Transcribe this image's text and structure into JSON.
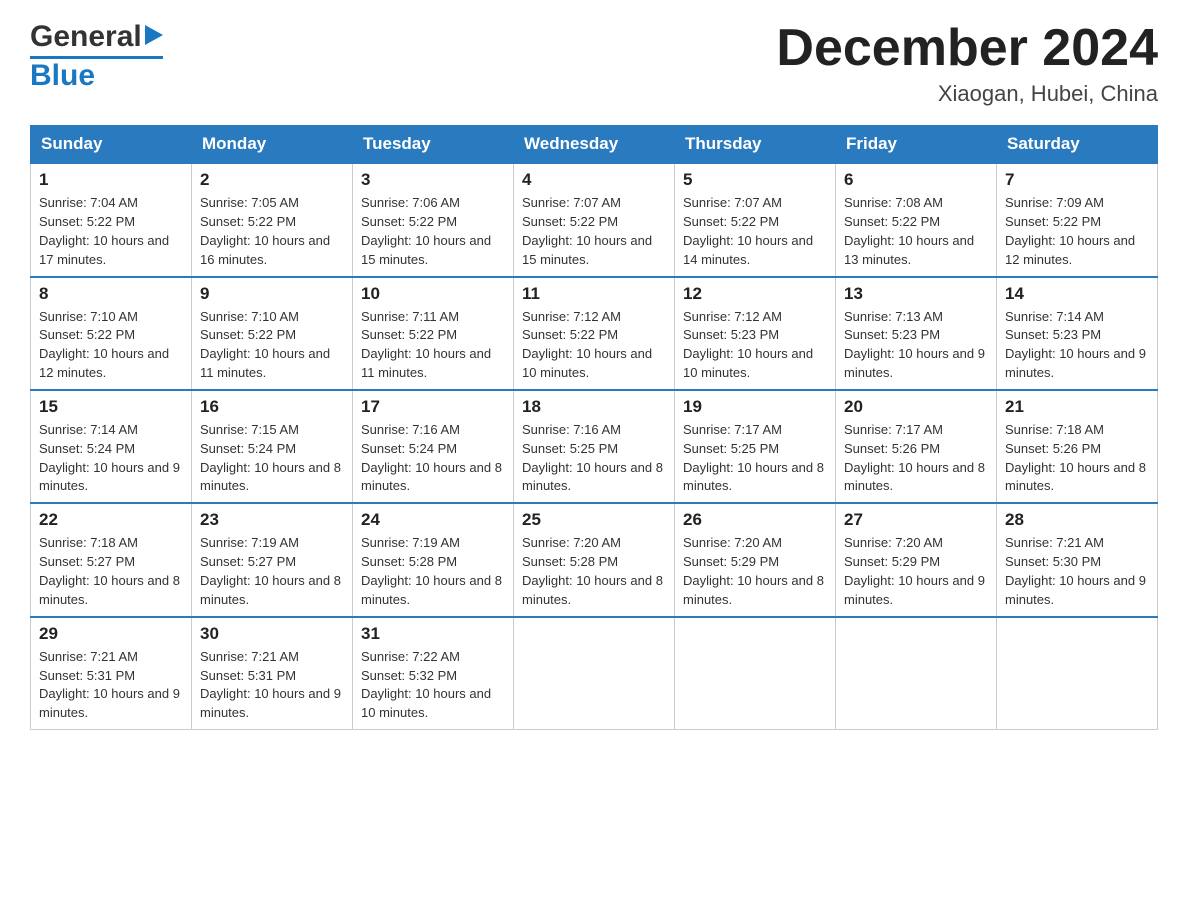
{
  "header": {
    "month_title": "December 2024",
    "location": "Xiaogan, Hubei, China",
    "logo_general": "General",
    "logo_blue": "Blue"
  },
  "days_of_week": [
    "Sunday",
    "Monday",
    "Tuesday",
    "Wednesday",
    "Thursday",
    "Friday",
    "Saturday"
  ],
  "weeks": [
    [
      {
        "day": "1",
        "sunrise": "7:04 AM",
        "sunset": "5:22 PM",
        "daylight": "10 hours and 17 minutes."
      },
      {
        "day": "2",
        "sunrise": "7:05 AM",
        "sunset": "5:22 PM",
        "daylight": "10 hours and 16 minutes."
      },
      {
        "day": "3",
        "sunrise": "7:06 AM",
        "sunset": "5:22 PM",
        "daylight": "10 hours and 15 minutes."
      },
      {
        "day": "4",
        "sunrise": "7:07 AM",
        "sunset": "5:22 PM",
        "daylight": "10 hours and 15 minutes."
      },
      {
        "day": "5",
        "sunrise": "7:07 AM",
        "sunset": "5:22 PM",
        "daylight": "10 hours and 14 minutes."
      },
      {
        "day": "6",
        "sunrise": "7:08 AM",
        "sunset": "5:22 PM",
        "daylight": "10 hours and 13 minutes."
      },
      {
        "day": "7",
        "sunrise": "7:09 AM",
        "sunset": "5:22 PM",
        "daylight": "10 hours and 12 minutes."
      }
    ],
    [
      {
        "day": "8",
        "sunrise": "7:10 AM",
        "sunset": "5:22 PM",
        "daylight": "10 hours and 12 minutes."
      },
      {
        "day": "9",
        "sunrise": "7:10 AM",
        "sunset": "5:22 PM",
        "daylight": "10 hours and 11 minutes."
      },
      {
        "day": "10",
        "sunrise": "7:11 AM",
        "sunset": "5:22 PM",
        "daylight": "10 hours and 11 minutes."
      },
      {
        "day": "11",
        "sunrise": "7:12 AM",
        "sunset": "5:22 PM",
        "daylight": "10 hours and 10 minutes."
      },
      {
        "day": "12",
        "sunrise": "7:12 AM",
        "sunset": "5:23 PM",
        "daylight": "10 hours and 10 minutes."
      },
      {
        "day": "13",
        "sunrise": "7:13 AM",
        "sunset": "5:23 PM",
        "daylight": "10 hours and 9 minutes."
      },
      {
        "day": "14",
        "sunrise": "7:14 AM",
        "sunset": "5:23 PM",
        "daylight": "10 hours and 9 minutes."
      }
    ],
    [
      {
        "day": "15",
        "sunrise": "7:14 AM",
        "sunset": "5:24 PM",
        "daylight": "10 hours and 9 minutes."
      },
      {
        "day": "16",
        "sunrise": "7:15 AM",
        "sunset": "5:24 PM",
        "daylight": "10 hours and 8 minutes."
      },
      {
        "day": "17",
        "sunrise": "7:16 AM",
        "sunset": "5:24 PM",
        "daylight": "10 hours and 8 minutes."
      },
      {
        "day": "18",
        "sunrise": "7:16 AM",
        "sunset": "5:25 PM",
        "daylight": "10 hours and 8 minutes."
      },
      {
        "day": "19",
        "sunrise": "7:17 AM",
        "sunset": "5:25 PM",
        "daylight": "10 hours and 8 minutes."
      },
      {
        "day": "20",
        "sunrise": "7:17 AM",
        "sunset": "5:26 PM",
        "daylight": "10 hours and 8 minutes."
      },
      {
        "day": "21",
        "sunrise": "7:18 AM",
        "sunset": "5:26 PM",
        "daylight": "10 hours and 8 minutes."
      }
    ],
    [
      {
        "day": "22",
        "sunrise": "7:18 AM",
        "sunset": "5:27 PM",
        "daylight": "10 hours and 8 minutes."
      },
      {
        "day": "23",
        "sunrise": "7:19 AM",
        "sunset": "5:27 PM",
        "daylight": "10 hours and 8 minutes."
      },
      {
        "day": "24",
        "sunrise": "7:19 AM",
        "sunset": "5:28 PM",
        "daylight": "10 hours and 8 minutes."
      },
      {
        "day": "25",
        "sunrise": "7:20 AM",
        "sunset": "5:28 PM",
        "daylight": "10 hours and 8 minutes."
      },
      {
        "day": "26",
        "sunrise": "7:20 AM",
        "sunset": "5:29 PM",
        "daylight": "10 hours and 8 minutes."
      },
      {
        "day": "27",
        "sunrise": "7:20 AM",
        "sunset": "5:29 PM",
        "daylight": "10 hours and 9 minutes."
      },
      {
        "day": "28",
        "sunrise": "7:21 AM",
        "sunset": "5:30 PM",
        "daylight": "10 hours and 9 minutes."
      }
    ],
    [
      {
        "day": "29",
        "sunrise": "7:21 AM",
        "sunset": "5:31 PM",
        "daylight": "10 hours and 9 minutes."
      },
      {
        "day": "30",
        "sunrise": "7:21 AM",
        "sunset": "5:31 PM",
        "daylight": "10 hours and 9 minutes."
      },
      {
        "day": "31",
        "sunrise": "7:22 AM",
        "sunset": "5:32 PM",
        "daylight": "10 hours and 10 minutes."
      },
      null,
      null,
      null,
      null
    ]
  ]
}
